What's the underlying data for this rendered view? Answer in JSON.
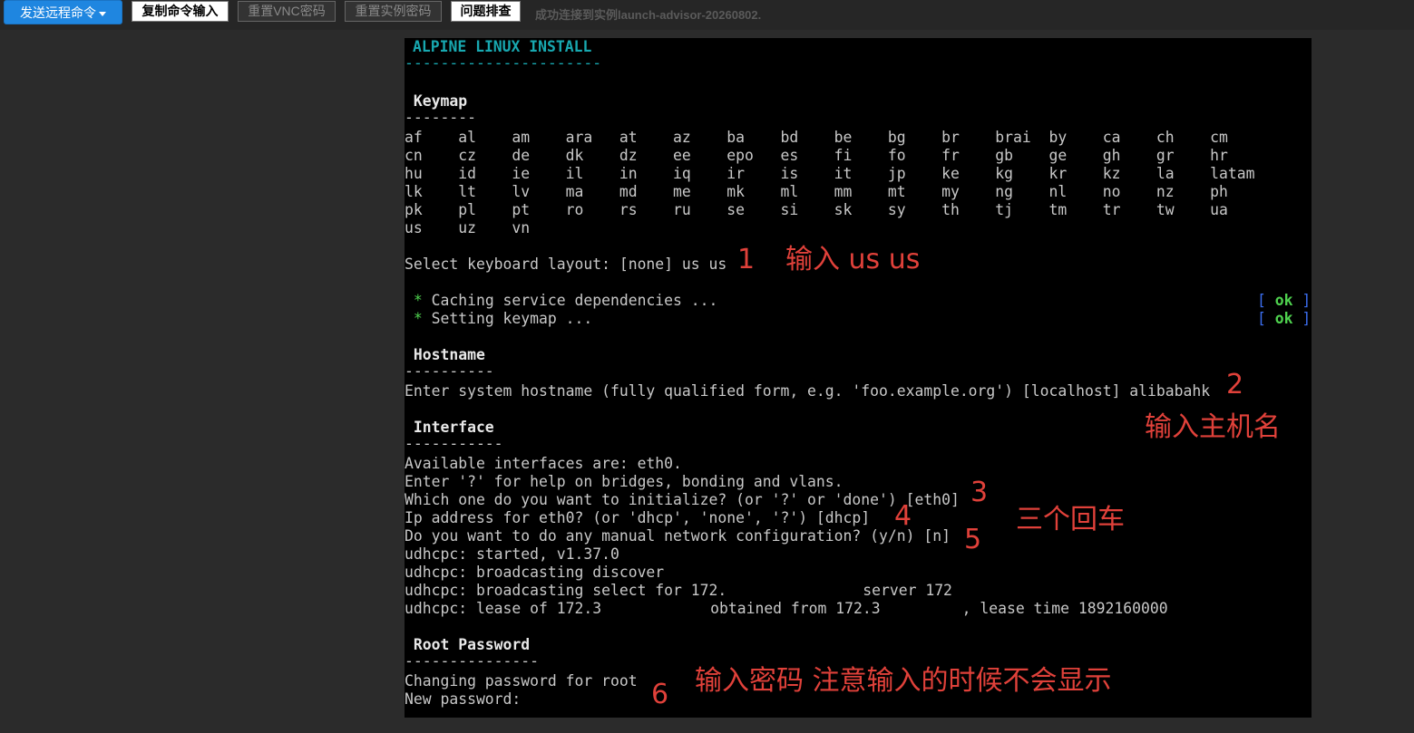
{
  "toolbar": {
    "send_command": "发送远程命令",
    "copy_input": "复制命令输入",
    "reset_vnc": "重置VNC密码",
    "reset_instance": "重置实例密码",
    "troubleshoot": "问题排查",
    "status": "成功连接到实例launch-advisor-20260802."
  },
  "terminal": {
    "title": "ALPINE LINUX INSTALL",
    "title_rule": "----------------------",
    "keymap_header": " Keymap",
    "keymap_rule": "--------",
    "keymap_rows": [
      "af    al    am    ara   at    az    ba    bd    be    bg    br    brai  by    ca    ch    cm",
      "cn    cz    de    dk    dz    ee    epo   es    fi    fo    fr    gb    ge    gh    gr    hr",
      "hu    id    ie    il    in    iq    ir    is    it    jp    ke    kg    kr    kz    la    latam",
      "lk    lt    lv    ma    md    me    mk    ml    mm    mt    my    ng    nl    no    nz    ph",
      "pk    pl    pt    ro    rs    ru    se    si    sk    sy    th    tj    tm    tr    tw    ua",
      "us    uz    vn"
    ],
    "select_layout": "Select keyboard layout: [none] us us",
    "service_star": " * ",
    "caching": "Caching service dependencies ...",
    "setting_keymap": "Setting keymap ...",
    "ok_bracket_open": "[ ",
    "ok_text": "ok",
    "ok_bracket_close": " ]",
    "hostname_header": " Hostname",
    "hostname_rule": "----------",
    "hostname_prompt": "Enter system hostname (fully qualified form, e.g. 'foo.example.org') [localhost] alibabahk",
    "interface_header": " Interface",
    "interface_rule": "-----------",
    "interface_lines": [
      "Available interfaces are: eth0.",
      "Enter '?' for help on bridges, bonding and vlans.",
      "Which one do you want to initialize? (or '?' or 'done') [eth0]",
      "Ip address for eth0? (or 'dhcp', 'none', '?') [dhcp]",
      "Do you want to do any manual network configuration? (y/n) [n]",
      "udhcpc: started, v1.37.0",
      "udhcpc: broadcasting discover",
      "udhcpc: broadcasting select for 172.",
      "udhcpc: lease of 172.3",
      "udhcpc: lease of 172.3"
    ],
    "dhcp_select_tail": "server 172",
    "lease_mid": "obtained from 172.3",
    "lease_tail": ", lease time 1892160000",
    "root_header": " Root Password",
    "root_rule": "---------------",
    "root_lines": [
      "Changing password for root",
      "New password:"
    ]
  },
  "annotations": {
    "n1": "1",
    "a1": "输入 us us",
    "n2": "2",
    "a2": "输入主机名",
    "n3": "3",
    "n4": "4",
    "n5": "5",
    "a3": "三个回车",
    "n6": "6",
    "a4": "输入密码 注意输入的时候不会显示"
  }
}
